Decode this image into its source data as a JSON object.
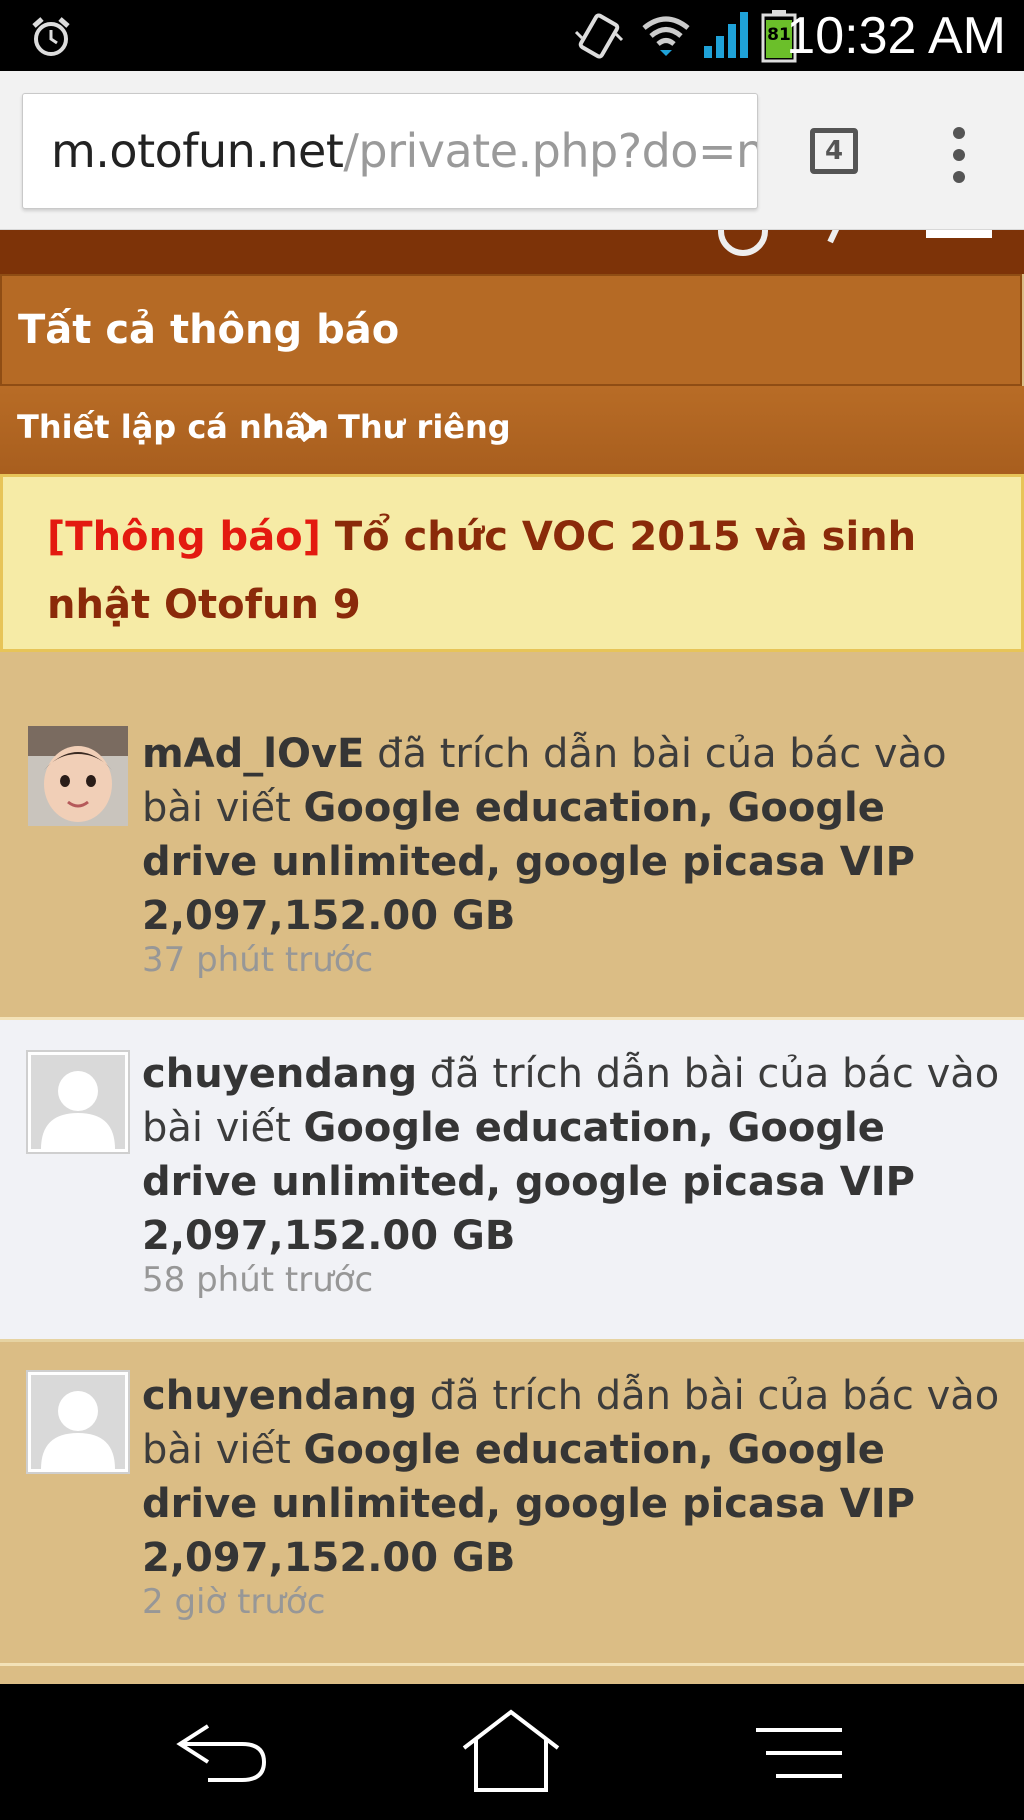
{
  "status_bar": {
    "time": "10:32 AM",
    "battery_level": "81",
    "icons": [
      "alarm-icon",
      "vibrate-icon",
      "wifi-icon",
      "signal-icon",
      "battery-icon"
    ]
  },
  "browser": {
    "url_host": "m.otofun.net",
    "url_path": "/private.php?do=n",
    "tab_count": "4"
  },
  "page": {
    "heading": "Tất cả thông báo",
    "breadcrumb": [
      "Thiết lập cá nhân",
      "Thư riêng"
    ],
    "announcement": {
      "tag": "[Thông báo]",
      "text": " Tổ chức VOC 2015 và sinh nhật Otofun 9"
    }
  },
  "notifications": [
    {
      "user": "mAd_lOvE",
      "action": " đã trích dẫn bài của bác vào bài viết ",
      "thread": "Google education, Google drive unlimited, google picasa VIP 2,097,152.00 GB",
      "time": "37 phút trước",
      "avatar": "photo"
    },
    {
      "user": "chuyendang",
      "action": " đã trích dẫn bài của bác vào bài viết ",
      "thread": "Google education, Google drive unlimited, google picasa VIP 2,097,152.00 GB",
      "time": "58 phút trước",
      "avatar": "default"
    },
    {
      "user": "chuyendang",
      "action": " đã trích dẫn bài của bác vào bài viết ",
      "thread": "Google education, Google drive unlimited, google picasa VIP 2,097,152.00 GB",
      "time": "2 giờ trước",
      "avatar": "default"
    }
  ],
  "colors": {
    "header_dark": "#7d3308",
    "heading_bg": "#b56a25",
    "announce_bg": "#f6eba6",
    "announce_tag": "#e31a10",
    "row_odd": "#dbbd85",
    "row_even": "#f1f2f6"
  }
}
